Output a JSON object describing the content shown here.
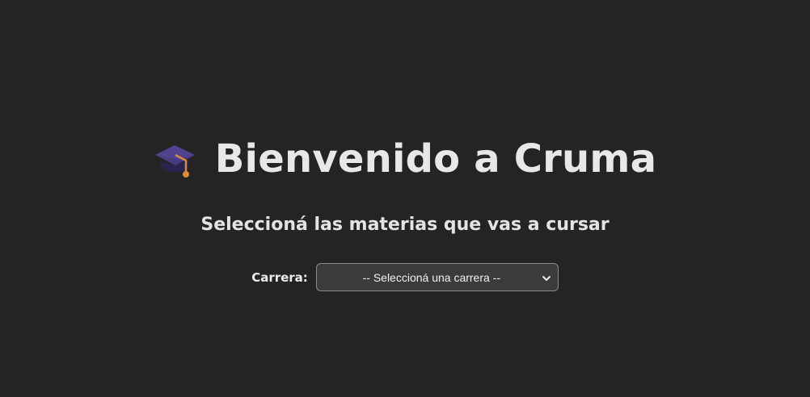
{
  "header": {
    "icon": "graduation-cap-icon",
    "title": "Bienvenido a Cruma",
    "subtitle": "Seleccioná las materias que vas a cursar"
  },
  "form": {
    "career_label": "Carrera:",
    "career_select": {
      "selected": "-- Seleccioná una carrera --"
    }
  },
  "colors": {
    "background": "#242424",
    "text": "#e6e6e6",
    "select_background": "#3b3b3b",
    "select_border": "#8a8a8a"
  }
}
